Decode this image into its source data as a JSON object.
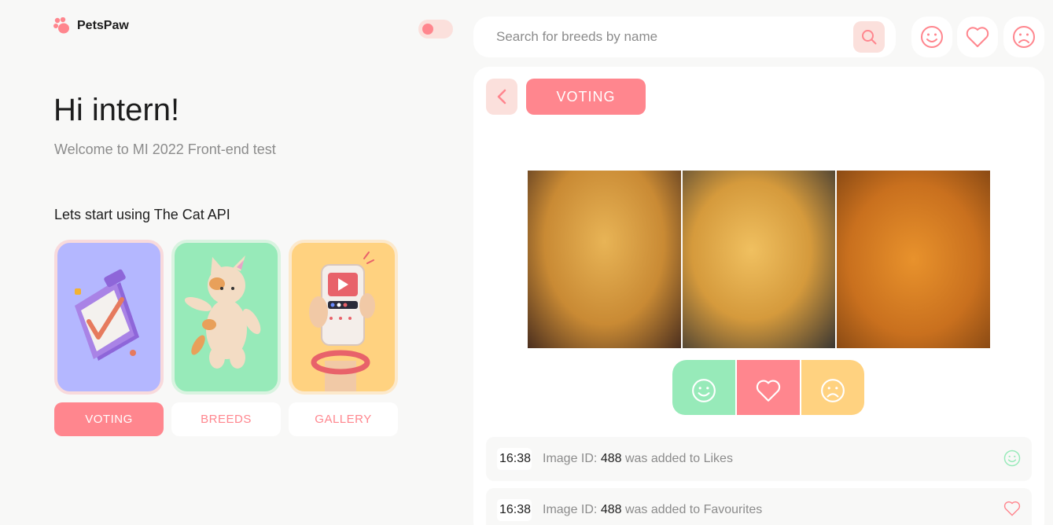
{
  "brand": {
    "name": "PetsPaw"
  },
  "hero": {
    "title": "Hi intern!",
    "subtitle": "Welcome to MI 2022 Front-end test",
    "start_text": "Lets start using The Cat API"
  },
  "cards": [
    {
      "label": "VOTING",
      "active": true,
      "color": "#B4B7FF"
    },
    {
      "label": "BREEDS",
      "active": false,
      "color": "#97EAB9"
    },
    {
      "label": "GALLERY",
      "active": false,
      "color": "#FFD280"
    }
  ],
  "search": {
    "placeholder": "Search for breeds by name"
  },
  "breadcrumb": {
    "current": "VOTING"
  },
  "log": [
    {
      "time": "16:38",
      "prefix": "Image ID: ",
      "id": "488",
      "suffix": " was added to Likes",
      "icon": "smile-icon"
    },
    {
      "time": "16:38",
      "prefix": "Image ID: ",
      "id": "488",
      "suffix": " was added to Favourites",
      "icon": "heart-icon"
    }
  ],
  "colors": {
    "accent": "#FF868E",
    "accent_light": "#FBE0DC",
    "green": "#97EAB9",
    "yellow": "#FFD280",
    "purple": "#B4B7FF"
  }
}
